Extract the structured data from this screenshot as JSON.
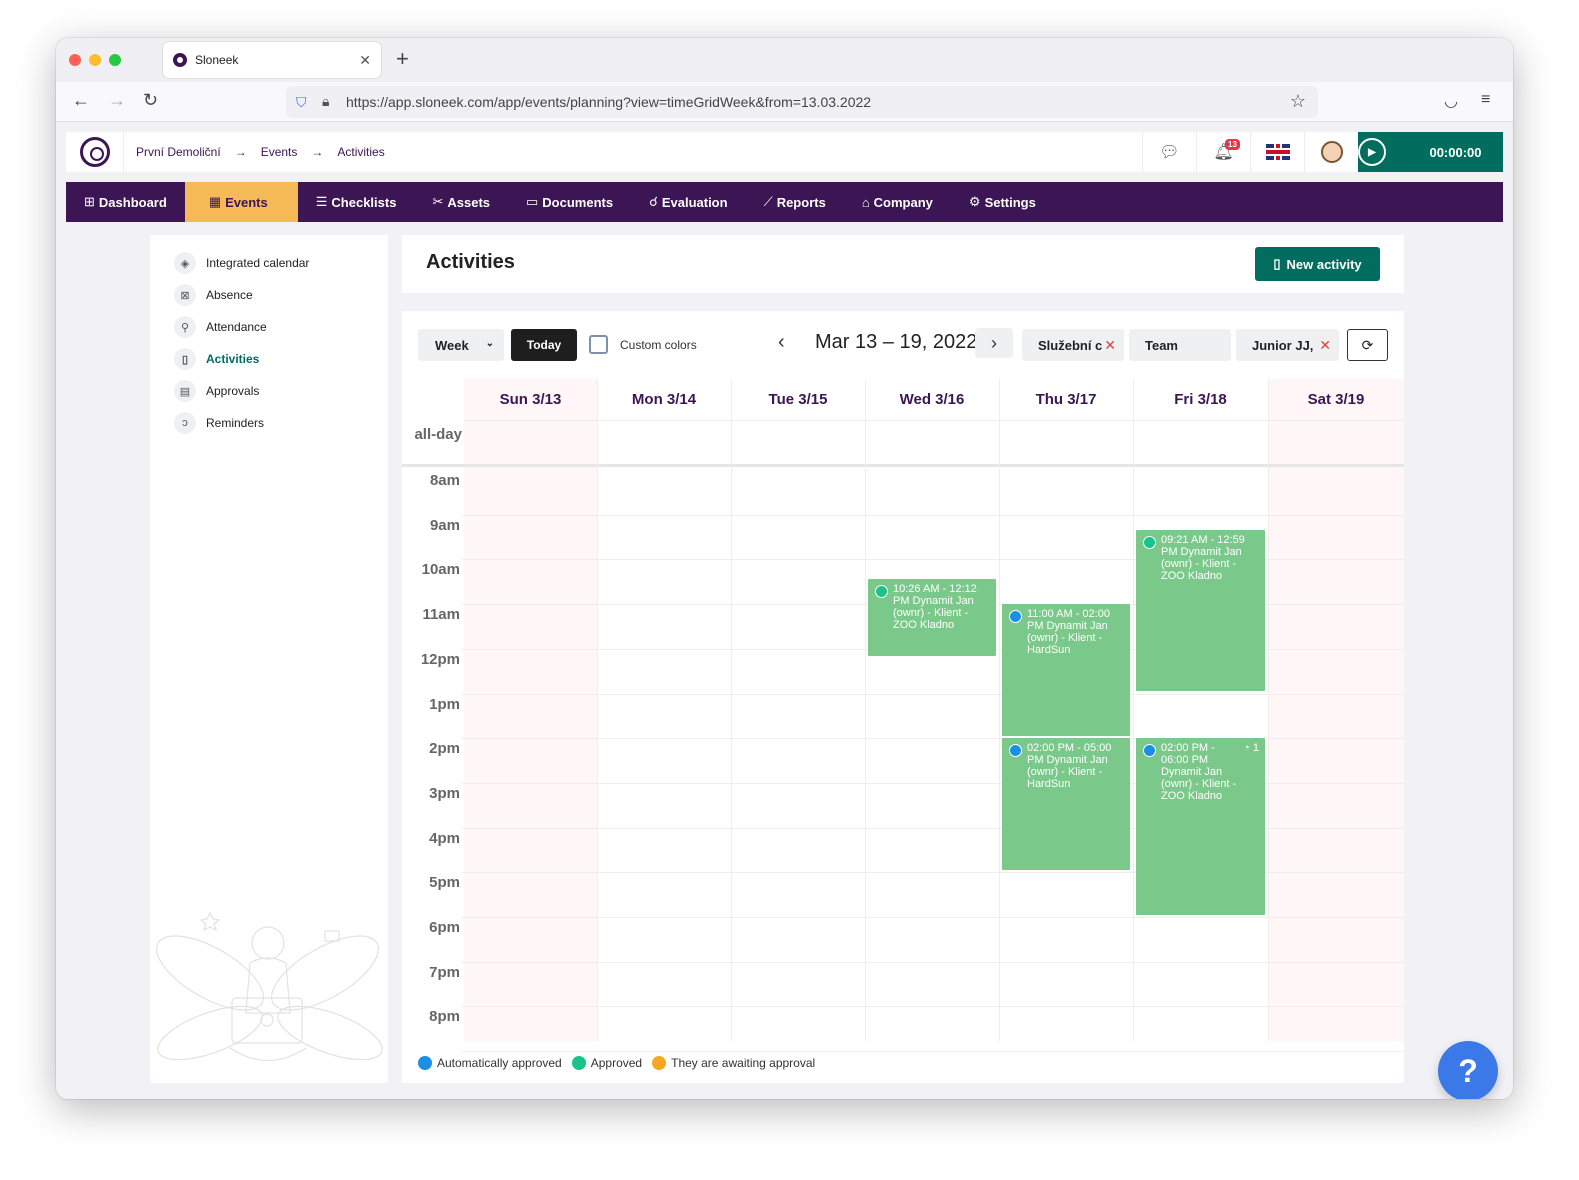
{
  "browser": {
    "tab_title": "Sloneek",
    "url": "https://app.sloneek.com/app/events/planning?view=timeGridWeek&from=13.03.2022"
  },
  "topbar": {
    "breadcrumbs": [
      "První Demoliční",
      "Events",
      "Activities"
    ],
    "notifications_count": "13",
    "timer": "00:00:00"
  },
  "nav": {
    "items": [
      {
        "label": "Dashboard",
        "icon": "grid-icon"
      },
      {
        "label": "Events",
        "icon": "calendar-icon"
      },
      {
        "label": "Checklists",
        "icon": "checklist-icon"
      },
      {
        "label": "Assets",
        "icon": "tools-icon"
      },
      {
        "label": "Documents",
        "icon": "folder-icon"
      },
      {
        "label": "Evaluation",
        "icon": "evaluation-icon"
      },
      {
        "label": "Reports",
        "icon": "chart-icon"
      },
      {
        "label": "Company",
        "icon": "building-icon"
      },
      {
        "label": "Settings",
        "icon": "gear-icon"
      }
    ],
    "active": "Events"
  },
  "sidebar": {
    "items": [
      {
        "label": "Integrated calendar",
        "icon": "layers-icon"
      },
      {
        "label": "Absence",
        "icon": "calendar-x-icon"
      },
      {
        "label": "Attendance",
        "icon": "walking-icon"
      },
      {
        "label": "Activities",
        "icon": "book-icon"
      },
      {
        "label": "Approvals",
        "icon": "clipboard-icon"
      },
      {
        "label": "Reminders",
        "icon": "ear-icon"
      }
    ],
    "active": "Activities"
  },
  "page": {
    "title": "Activities",
    "new_activity_label": "New activity"
  },
  "calendar": {
    "view_select": "Week",
    "today_label": "Today",
    "custom_colors_label": "Custom colors",
    "range_title": "Mar 13 – 19, 2022",
    "filters": [
      "Služební c",
      "Team",
      "Junior JJ, D"
    ],
    "days": [
      "Sun 3/13",
      "Mon 3/14",
      "Tue 3/15",
      "Wed 3/16",
      "Thu 3/17",
      "Fri 3/18",
      "Sat 3/19"
    ],
    "allday_label": "all-day",
    "hours": [
      "8am",
      "9am",
      "10am",
      "11am",
      "12pm",
      "1pm",
      "2pm",
      "3pm",
      "4pm",
      "5pm",
      "6pm",
      "7pm",
      "8pm"
    ],
    "events": [
      {
        "day": 3,
        "start": 10.43,
        "end": 12.2,
        "text": "10:26 AM - 12:12 PM Dynamit Jan (ownr) - Klient - ZOO Kladno",
        "status": "approved",
        "count": ""
      },
      {
        "day": 4,
        "start": 11.0,
        "end": 14.0,
        "text": "11:00 AM - 02:00 PM Dynamit Jan (ownr) - Klient - HardSun",
        "status": "auto",
        "count": ""
      },
      {
        "day": 5,
        "start": 9.35,
        "end": 12.98,
        "text": "09:21 AM - 12:59 PM Dynamit Jan (ownr) - Klient - ZOO Kladno",
        "status": "approved",
        "count": ""
      },
      {
        "day": 4,
        "start": 14.0,
        "end": 17.0,
        "text": "02:00 PM - 05:00 PM Dynamit Jan (ownr) - Klient - HardSun",
        "status": "auto",
        "count": ""
      },
      {
        "day": 5,
        "start": 14.0,
        "end": 18.0,
        "text": "02:00 PM - 06:00 PM Dynamit Jan (ownr) - Klient - ZOO Kladno",
        "status": "auto",
        "count": "1"
      }
    ]
  },
  "legend": [
    {
      "label": "Automatically approved",
      "color": "#1a8fe3"
    },
    {
      "label": "Approved",
      "color": "#18c48a"
    },
    {
      "label": "They are awaiting approval",
      "color": "#f5a623"
    }
  ],
  "colors": {
    "brand": "#3c1654",
    "accent": "#006d5f",
    "highlight": "#f5b955",
    "event": "#7bc98a"
  },
  "help_label": "?"
}
